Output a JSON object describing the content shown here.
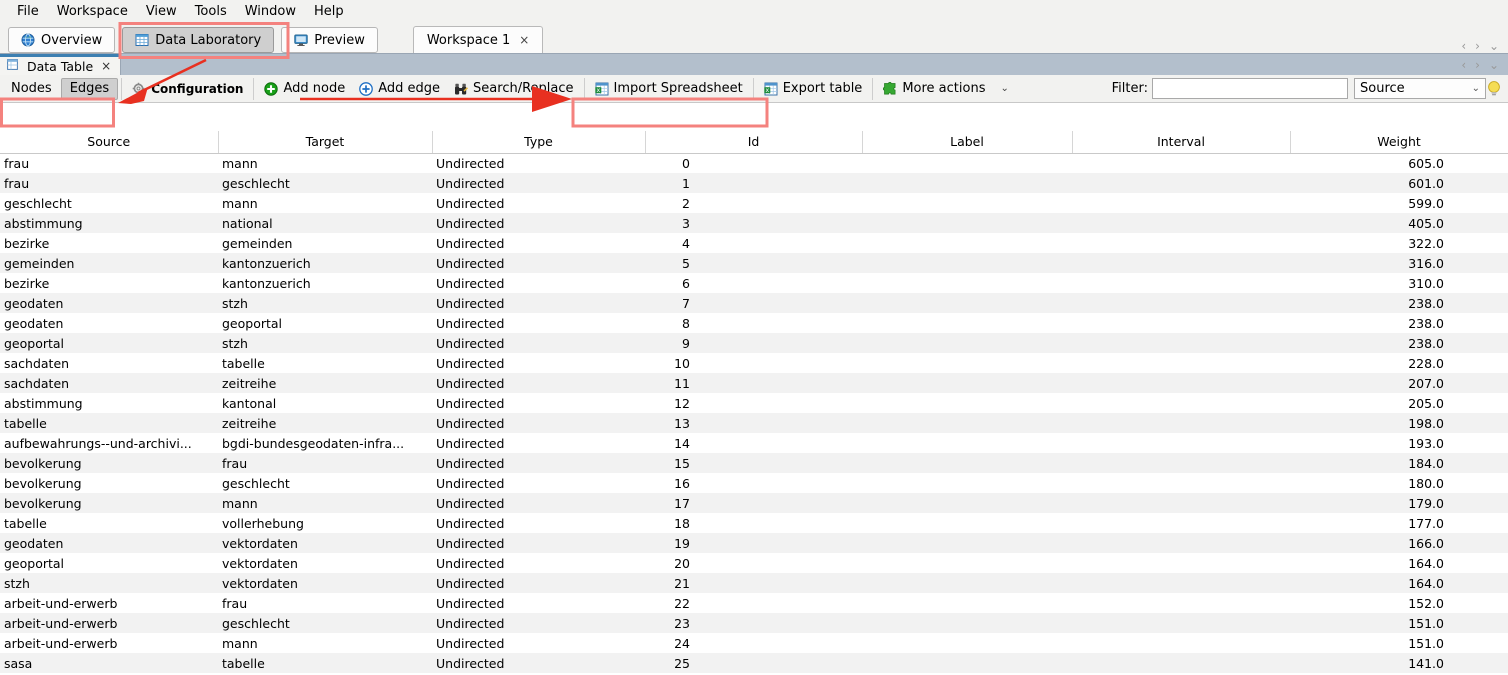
{
  "menu": {
    "items": [
      "File",
      "Workspace",
      "View",
      "Tools",
      "Window",
      "Help"
    ]
  },
  "modes": {
    "buttons": [
      {
        "label": "Overview",
        "icon": "globe-icon",
        "active": false
      },
      {
        "label": "Data Laboratory",
        "icon": "table-grid-icon",
        "active": true
      },
      {
        "label": "Preview",
        "icon": "monitor-icon",
        "active": false
      }
    ]
  },
  "workspace_tabs": {
    "tabs": [
      {
        "label": "Workspace 1",
        "close": "×"
      }
    ],
    "nav": {
      "prev": "‹",
      "next": "›",
      "list": "⌄"
    }
  },
  "data_table_window": {
    "tab_label": "Data Table",
    "tab_close": "×",
    "tab_icon": "table-icon",
    "nav": {
      "prev": "‹",
      "next": "›",
      "list": "⌄"
    }
  },
  "toolbar": {
    "nodes_label": "Nodes",
    "edges_label": "Edges",
    "active_segment": "Edges",
    "configuration_label": "Configuration",
    "configuration_icon": "gear-icon",
    "add_node_label": "Add node",
    "add_node_icon": "plus-circle-green-icon",
    "add_edge_label": "Add edge",
    "add_edge_icon": "plus-circle-blue-icon",
    "search_replace_label": "Search/Replace",
    "search_replace_icon": "binoculars-icon",
    "import_spreadsheet_label": "Import Spreadsheet",
    "import_spreadsheet_icon": "spreadsheet-icon",
    "export_table_label": "Export table",
    "export_table_icon": "spreadsheet-icon",
    "more_actions_label": "More actions",
    "more_actions_icon": "puzzle-icon",
    "more_actions_chevron": "⌄",
    "filter_label": "Filter:",
    "filter_value": "",
    "filter_placeholder": "",
    "filter_column": "Source",
    "filter_column_chevron": "⌄",
    "hint_icon": "lightbulb-icon"
  },
  "table": {
    "columns": [
      "Source",
      "Target",
      "Type",
      "Id",
      "Label",
      "Interval",
      "Weight"
    ],
    "rows": [
      [
        "frau",
        "mann",
        "Undirected",
        "0",
        "",
        "",
        "605.0"
      ],
      [
        "frau",
        "geschlecht",
        "Undirected",
        "1",
        "",
        "",
        "601.0"
      ],
      [
        "geschlecht",
        "mann",
        "Undirected",
        "2",
        "",
        "",
        "599.0"
      ],
      [
        "abstimmung",
        "national",
        "Undirected",
        "3",
        "",
        "",
        "405.0"
      ],
      [
        "bezirke",
        "gemeinden",
        "Undirected",
        "4",
        "",
        "",
        "322.0"
      ],
      [
        "gemeinden",
        "kantonzuerich",
        "Undirected",
        "5",
        "",
        "",
        "316.0"
      ],
      [
        "bezirke",
        "kantonzuerich",
        "Undirected",
        "6",
        "",
        "",
        "310.0"
      ],
      [
        "geodaten",
        "stzh",
        "Undirected",
        "7",
        "",
        "",
        "238.0"
      ],
      [
        "geodaten",
        "geoportal",
        "Undirected",
        "8",
        "",
        "",
        "238.0"
      ],
      [
        "geoportal",
        "stzh",
        "Undirected",
        "9",
        "",
        "",
        "238.0"
      ],
      [
        "sachdaten",
        "tabelle",
        "Undirected",
        "10",
        "",
        "",
        "228.0"
      ],
      [
        "sachdaten",
        "zeitreihe",
        "Undirected",
        "11",
        "",
        "",
        "207.0"
      ],
      [
        "abstimmung",
        "kantonal",
        "Undirected",
        "12",
        "",
        "",
        "205.0"
      ],
      [
        "tabelle",
        "zeitreihe",
        "Undirected",
        "13",
        "",
        "",
        "198.0"
      ],
      [
        "aufbewahrungs--und-archivi...",
        "bgdi-bundesgeodaten-infra...",
        "Undirected",
        "14",
        "",
        "",
        "193.0"
      ],
      [
        "bevolkerung",
        "frau",
        "Undirected",
        "15",
        "",
        "",
        "184.0"
      ],
      [
        "bevolkerung",
        "geschlecht",
        "Undirected",
        "16",
        "",
        "",
        "180.0"
      ],
      [
        "bevolkerung",
        "mann",
        "Undirected",
        "17",
        "",
        "",
        "179.0"
      ],
      [
        "tabelle",
        "vollerhebung",
        "Undirected",
        "18",
        "",
        "",
        "177.0"
      ],
      [
        "geodaten",
        "vektordaten",
        "Undirected",
        "19",
        "",
        "",
        "166.0"
      ],
      [
        "geoportal",
        "vektordaten",
        "Undirected",
        "20",
        "",
        "",
        "164.0"
      ],
      [
        "stzh",
        "vektordaten",
        "Undirected",
        "21",
        "",
        "",
        "164.0"
      ],
      [
        "arbeit-und-erwerb",
        "frau",
        "Undirected",
        "22",
        "",
        "",
        "152.0"
      ],
      [
        "arbeit-und-erwerb",
        "geschlecht",
        "Undirected",
        "23",
        "",
        "",
        "151.0"
      ],
      [
        "arbeit-und-erwerb",
        "mann",
        "Undirected",
        "24",
        "",
        "",
        "151.0"
      ],
      [
        "sasa",
        "tabelle",
        "Undirected",
        "25",
        "",
        "",
        "141.0"
      ]
    ]
  },
  "annotations": {
    "color": "#f4827e",
    "arrow_color": "#e83020",
    "highlights": [
      "Data Laboratory",
      "Nodes Edges",
      "Import Spreadsheet"
    ]
  }
}
